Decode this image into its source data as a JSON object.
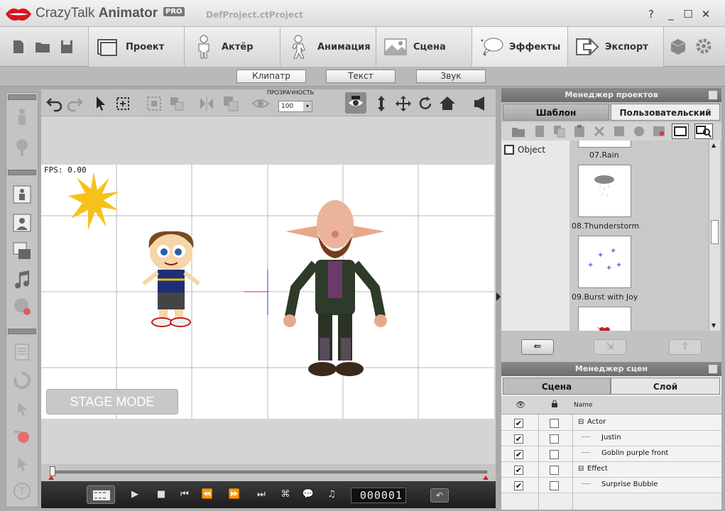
{
  "app": {
    "name_plain": "CrazyTalk",
    "name_bold": "Animator",
    "edition": "PRO",
    "file": "DefProject.ctProject",
    "window_buttons": [
      "?",
      "_",
      "☐",
      "✕"
    ]
  },
  "nav": {
    "tabs": [
      {
        "label": "Проект",
        "icon": "project-icon"
      },
      {
        "label": "Актёр",
        "icon": "actor-icon"
      },
      {
        "label": "Анимация",
        "icon": "animation-icon"
      },
      {
        "label": "Сцена",
        "icon": "scene-icon"
      },
      {
        "label": "Эффекты",
        "icon": "effects-icon",
        "active": true
      },
      {
        "label": "Экспорт",
        "icon": "export-icon"
      }
    ]
  },
  "subtabs": [
    "Клипатр",
    "Текст",
    "Звук"
  ],
  "toolbar": {
    "opacity_label": "ПРОЗРАЧНОСТЬ",
    "opacity_value": "100"
  },
  "stage": {
    "fps": "FPS: 0.00",
    "mode_label": "STAGE MODE"
  },
  "playback": {
    "frame": "000001"
  },
  "project_manager": {
    "title": "Менеджер проектов",
    "tabs": [
      "Шаблон",
      "Пользовательский"
    ],
    "active_tab": 1,
    "tree_item": "Object",
    "items": [
      {
        "label": "07.Rain"
      },
      {
        "label": "08.Thunderstorm"
      },
      {
        "label": "09.Burst with Joy"
      }
    ]
  },
  "scene_manager": {
    "title": "Менеджер сцен",
    "tabs": [
      "Сцена",
      "Слой"
    ],
    "name_header": "Name",
    "rows": [
      {
        "name": "Actor",
        "group": true,
        "visible": true
      },
      {
        "name": "Justin",
        "group": false,
        "visible": true
      },
      {
        "name": "Goblin purple front",
        "group": false,
        "visible": true
      },
      {
        "name": "Effect",
        "group": true,
        "visible": true
      },
      {
        "name": "Surprise Bubble",
        "group": false,
        "visible": true
      }
    ]
  },
  "colors": {
    "accent_red": "#d8141c",
    "sun": "#f6c21a",
    "panel_header": "#7a7a7a"
  }
}
